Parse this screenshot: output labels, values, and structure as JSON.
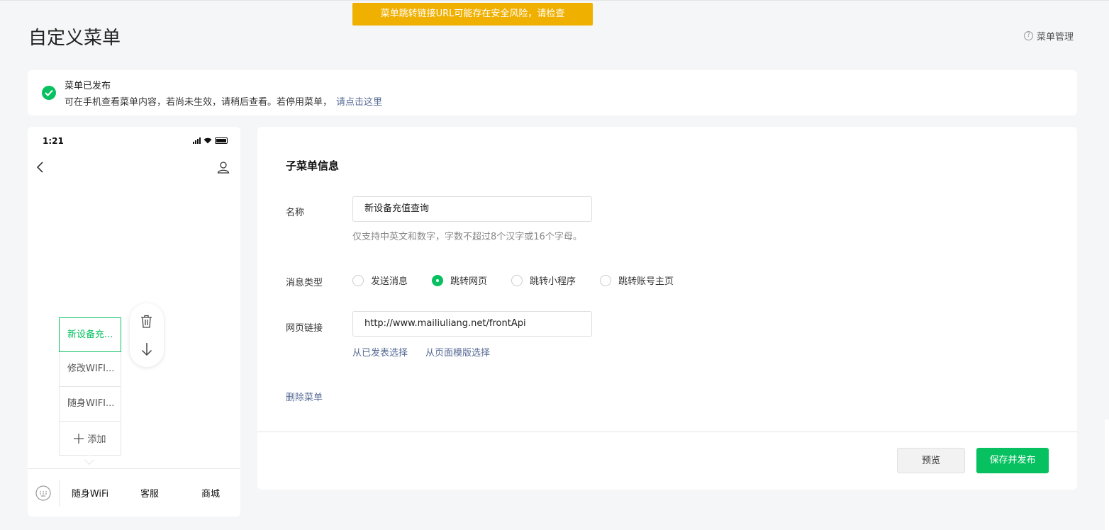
{
  "toast": {
    "text": "菜单跳转链接URL可能存在安全风险，请检查",
    "color": "#f0b000"
  },
  "header": {
    "title": "自定义菜单",
    "menu_manage": "菜单管理",
    "help_icon": "question-circle-icon"
  },
  "notice": {
    "title": "菜单已发布",
    "desc": "可在手机查看菜单内容，若尚未生效，请稍后查看。若停用菜单，",
    "link": "请点击这里",
    "icon": "check-circle-icon"
  },
  "phone": {
    "time": "1:21",
    "submenu": [
      {
        "label": "新设备充...",
        "active": true
      },
      {
        "label": "修改WIFI...",
        "active": false
      },
      {
        "label": "随身WIFI...",
        "active": false
      }
    ],
    "add_label": "添加",
    "bottom_menu": [
      "随身WiFi",
      "客服",
      "商城"
    ]
  },
  "form": {
    "section_title": "子菜单信息",
    "name_label": "名称",
    "name_value": "新设备充值查询",
    "name_hint": "仅支持中英文和数字，字数不超过8个汉字或16个字母。",
    "type_label": "消息类型",
    "type_options": [
      "发送消息",
      "跳转网页",
      "跳转小程序",
      "跳转账号主页"
    ],
    "type_selected": "跳转网页",
    "url_label": "网页链接",
    "url_value": "http://www.mailiuliang.net/frontApi",
    "url_link_published": "从已发表选择",
    "url_link_template": "从页面模版选择",
    "delete_label": "删除菜单",
    "preview_button": "预览",
    "publish_button": "保存并发布"
  },
  "colors": {
    "brand_green": "#07c160",
    "link_blue": "#576b95",
    "warning": "#f0b000"
  }
}
